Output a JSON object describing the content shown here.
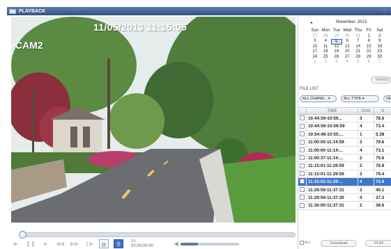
{
  "window": {
    "title": "PLAYBACK"
  },
  "video": {
    "timestamp": "11/05/2013 11:15:05",
    "camera": "CAM2"
  },
  "controls": {
    "speed": "1x",
    "speed_time": "00:00:00:00"
  },
  "calendar": {
    "month_label": "November, 2013",
    "prev_arrow": "◂",
    "weekdays": [
      "Sun",
      "Mon",
      "Tue",
      "Wed",
      "Thu",
      "Fri",
      "Sat"
    ],
    "weeks": [
      [
        "27",
        "28",
        "29",
        "30",
        "31",
        "1",
        "2"
      ],
      [
        "3",
        "4",
        "5",
        "6",
        "7",
        "8",
        "9"
      ],
      [
        "10",
        "11",
        "12",
        "13",
        "14",
        "15",
        "16"
      ],
      [
        "17",
        "18",
        "19",
        "20",
        "21",
        "22",
        "23"
      ],
      [
        "24",
        "25",
        "26",
        "27",
        "28",
        "29",
        "30"
      ],
      [
        "1",
        "2",
        "3",
        "4",
        "5",
        "6",
        "7"
      ]
    ],
    "selected_day": "5",
    "refresh_label": "REFRES"
  },
  "file_list": {
    "label": "FILE LIST",
    "channel_select": "ALL CHANN...",
    "type_select": "ALL TYPE",
    "search_label": "SE",
    "columns": [
      "",
      "TIME",
      "CHA",
      "S"
    ],
    "rows": [
      {
        "time": "10:44:59-10:59...",
        "ch": "3",
        "size": "78.6"
      },
      {
        "time": "10:44:59-10:59:59",
        "ch": "4",
        "size": "73.4"
      },
      {
        "time": "10:54:48-10:55:...",
        "ch": "1",
        "size": "5.38"
      },
      {
        "time": "11:00:00-11:14:59",
        "ch": "3",
        "size": "79.6"
      },
      {
        "time": "11:00:00-11:14:...",
        "ch": "4",
        "size": "73.1"
      },
      {
        "time": "11:00:37-11:14:...",
        "ch": "2",
        "size": "75.6"
      },
      {
        "time": "11:15:01-11:29:59",
        "ch": "2",
        "size": "78.8"
      },
      {
        "time": "11:15:01-11:29:59",
        "ch": "3",
        "size": "79.4"
      },
      {
        "time": "11:15:01-11:29:...",
        "ch": "4",
        "size": "73.9"
      },
      {
        "time": "11:29:59-11:37:31",
        "ch": "3",
        "size": "40.1"
      },
      {
        "time": "11:29:59-11:37:30",
        "ch": "4",
        "size": "37.3"
      },
      {
        "time": "11:30:00-11:37:31",
        "ch": "2",
        "size": "38.6"
      }
    ],
    "selected_row": 8
  },
  "footer": {
    "all_label": "ALL",
    "download_label": "Download",
    "play_label": "PLAY"
  },
  "colors": {
    "accent": "#3f76c9",
    "titlebar": "#34507e"
  }
}
